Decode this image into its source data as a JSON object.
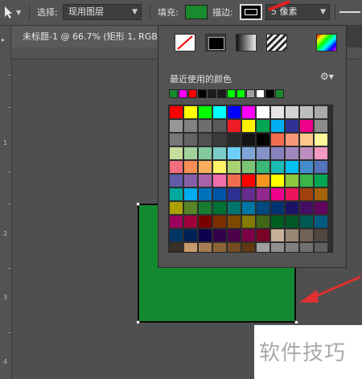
{
  "options_bar": {
    "select_label": "选择:",
    "select_value": "现用图层",
    "fill_label": "填充:",
    "fill_color": "#1a8a2e",
    "stroke_label": "描边:",
    "stroke_width": "5 像素"
  },
  "document": {
    "tab_title": "未标题-1 @ 66.7% (矩形 1, RGB"
  },
  "ruler": {
    "vertical_numbers": [
      "1",
      "2",
      "3",
      "4"
    ]
  },
  "swatch_panel": {
    "recent_label": "最近使用的颜色",
    "recent_colors": [
      "#1a8a2e",
      "#ff00ff",
      "#ff0000",
      "#000000",
      "#1c1c1c",
      "#1a1a1a",
      "#00ff00",
      "#00ff00",
      "#a0a0a0",
      "#ffffff",
      "#000000",
      "#1a8a2e"
    ],
    "grid_colors": [
      [
        "#ff0000",
        "#ffff00",
        "#00ff00",
        "#00ffff",
        "#0000ff",
        "#ff00ff",
        "#ffffff",
        "#e6e6e6",
        "#d2d2d2",
        "#bebebe",
        "#aaaaaa"
      ],
      [
        "#969696",
        "#828282",
        "#6e6e6e",
        "#5a5a5a",
        "#ed1c24",
        "#fff200",
        "#00a651",
        "#00aeef",
        "#2e3192",
        "#ec008c",
        "#8c8c8c"
      ],
      [
        "#787878",
        "#646464",
        "#505050",
        "#3c3c3c",
        "#282828",
        "#141414",
        "#000000",
        "#f26c4f",
        "#f7977a",
        "#fdc68a",
        "#fff79a"
      ],
      [
        "#c4df9b",
        "#a3d39c",
        "#82ca9d",
        "#7accc8",
        "#6dcff6",
        "#7ea7d8",
        "#8393ca",
        "#8781bd",
        "#a187be",
        "#bc8dbf",
        "#f49ac2"
      ],
      [
        "#f26d7d",
        "#f68e56",
        "#fbaf5d",
        "#fff467",
        "#acd372",
        "#7cc576",
        "#3bb878",
        "#1abbb4",
        "#00bff3",
        "#438ccb",
        "#5574b9"
      ],
      [
        "#605ca8",
        "#855fa8",
        "#a863a8",
        "#f06eaa",
        "#f26c4f",
        "#ff0000",
        "#f7941d",
        "#ffff00",
        "#8dc63f",
        "#39b54a",
        "#00a651"
      ],
      [
        "#00a99d",
        "#00aeef",
        "#0072bc",
        "#0054a6",
        "#2e3192",
        "#662d91",
        "#92278f",
        "#ec008c",
        "#ed145b",
        "#a0410d",
        "#a36209"
      ],
      [
        "#aba000",
        "#598527",
        "#197b30",
        "#007236",
        "#00746b",
        "#0076a3",
        "#004a80",
        "#003471",
        "#1b1464",
        "#440e62",
        "#630460"
      ],
      [
        "#9e005d",
        "#9e0039",
        "#790000",
        "#7b2e00",
        "#7d4900",
        "#827b00",
        "#406618",
        "#005e20",
        "#005826",
        "#005952",
        "#005b7f"
      ],
      [
        "#003663",
        "#002157",
        "#0d004c",
        "#32004b",
        "#4b0049",
        "#7b0046",
        "#7a0026",
        "#c7b299",
        "#998675",
        "#736357",
        "#534741"
      ],
      [
        "#37302a",
        "#c69c6d",
        "#a67c52",
        "#8c6239",
        "#754c24",
        "#603913",
        "#a0a0a0",
        "#909090",
        "#808080",
        "#707070",
        "#606060"
      ]
    ]
  },
  "watermark": {
    "text": "软件技巧"
  }
}
